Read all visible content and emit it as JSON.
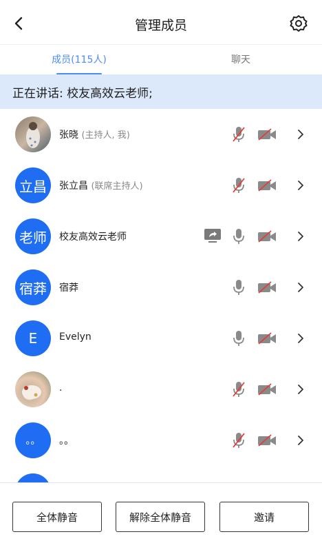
{
  "header": {
    "title": "管理成员"
  },
  "tabs": [
    {
      "label": "成员(115人)",
      "active": true
    },
    {
      "label": "聊天",
      "active": false
    }
  ],
  "speaking": {
    "text": "正在讲话: 校友高效云老师;"
  },
  "members": [
    {
      "avatar_text": "",
      "name": "张晓",
      "role": "(主持人, 我)",
      "mic_muted": true,
      "cam_off": true,
      "sharing": false
    },
    {
      "avatar_text": "立昌",
      "name": "张立昌",
      "role": "(联席主持人)",
      "mic_muted": true,
      "cam_off": true,
      "sharing": false
    },
    {
      "avatar_text": "老师",
      "name": "校友高效云老师",
      "role": "",
      "mic_muted": false,
      "cam_off": true,
      "sharing": true
    },
    {
      "avatar_text": "宿莽",
      "name": "宿莽",
      "role": "",
      "mic_muted": false,
      "cam_off": true,
      "sharing": false
    },
    {
      "avatar_text": "E",
      "name": "Evelyn",
      "role": "",
      "mic_muted": false,
      "cam_off": true,
      "sharing": false
    },
    {
      "avatar_text": "",
      "name": ".",
      "role": "",
      "mic_muted": true,
      "cam_off": true,
      "sharing": false
    },
    {
      "avatar_text": "。。",
      "name": "。。",
      "role": "",
      "mic_muted": true,
      "cam_off": true,
      "sharing": false
    }
  ],
  "actions": {
    "mute_all": "全体静音",
    "unmute_all": "解除全体静音",
    "invite": "邀请"
  },
  "colors": {
    "accent": "#4a8cf7",
    "avatar_blue": "#1f6df2",
    "speaking_bg": "#dce9fb",
    "mute_red": "#e53935"
  }
}
